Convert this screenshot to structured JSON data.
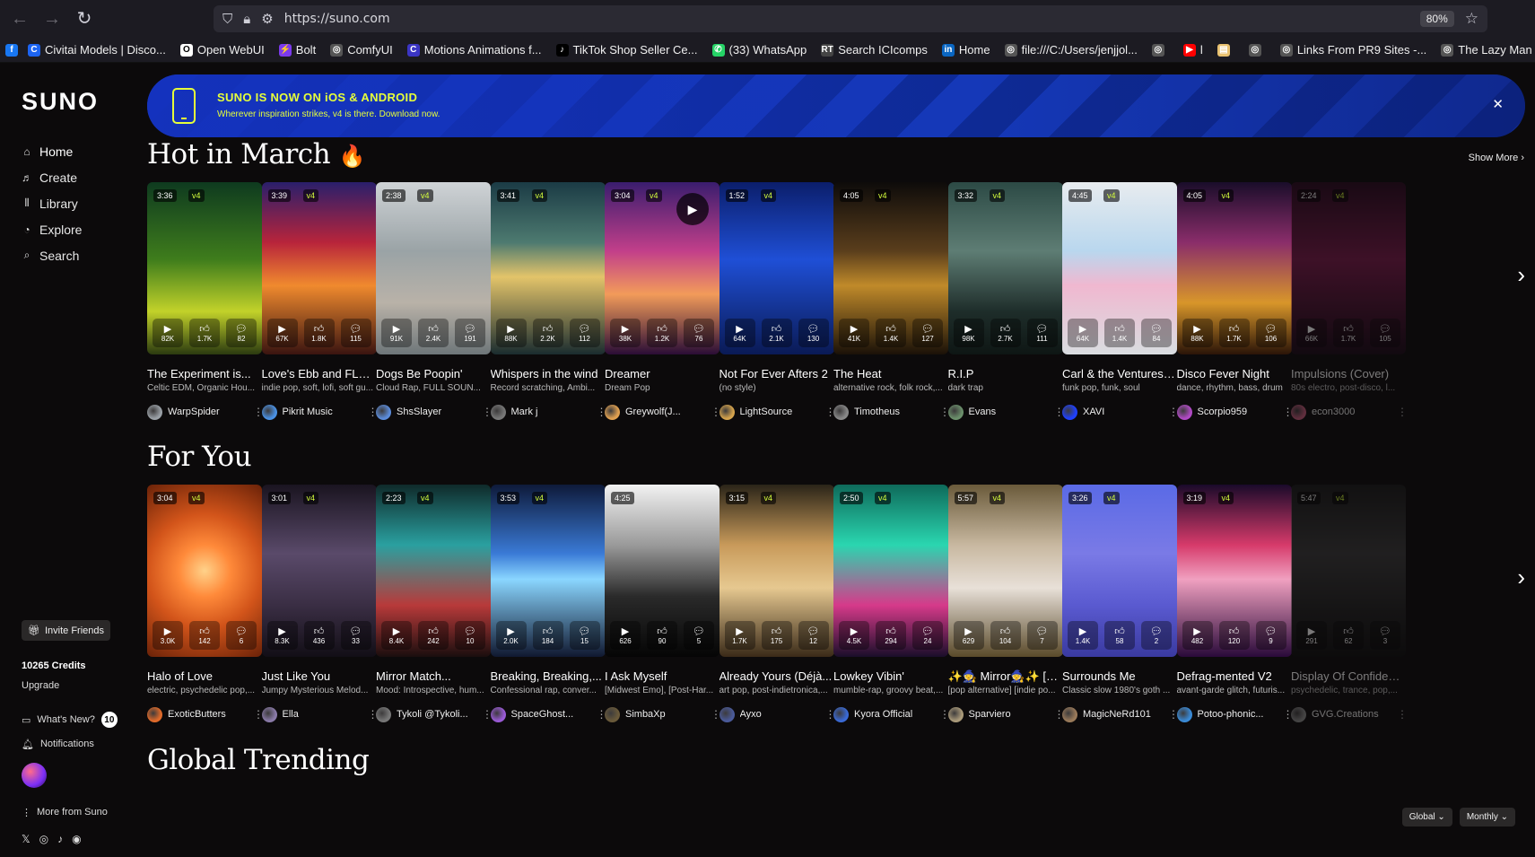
{
  "browser": {
    "url": "https://suno.com",
    "zoom": "80%",
    "bookmarks": [
      {
        "label": "Civitai Models | Disco...",
        "color": "#1c64f2",
        "glyph": "C"
      },
      {
        "label": "Open WebUI",
        "color": "#ffffff",
        "glyph": "O"
      },
      {
        "label": "Bolt",
        "color": "#7c3aed",
        "glyph": "⚡"
      },
      {
        "label": "ComfyUI",
        "color": "#555555",
        "glyph": "◎"
      },
      {
        "label": "Motions Animations f...",
        "color": "#3b35c4",
        "glyph": "C"
      },
      {
        "label": "TikTok Shop Seller Ce...",
        "color": "#000000",
        "glyph": "♪"
      },
      {
        "label": "(33) WhatsApp",
        "color": "#25d366",
        "glyph": "✆"
      },
      {
        "label": "Search ICIcomps",
        "color": "#444444",
        "glyph": "RT"
      },
      {
        "label": "Home",
        "color": "#0a66c2",
        "glyph": "in"
      },
      {
        "label": "file:///C:/Users/jenjjol...",
        "color": "#555555",
        "glyph": "◎"
      },
      {
        "label": "",
        "color": "#555555",
        "glyph": "◎"
      },
      {
        "label": "l",
        "color": "#ff0000",
        "glyph": "▶"
      },
      {
        "label": "",
        "color": "#e8c170",
        "glyph": "▤"
      },
      {
        "label": "",
        "color": "#555555",
        "glyph": "◎"
      },
      {
        "label": "Links From PR9 Sites -...",
        "color": "#555555",
        "glyph": "◎"
      },
      {
        "label": "The Lazy Man",
        "color": "#555555",
        "glyph": "◎"
      }
    ]
  },
  "sidebar": {
    "logo": "SUNO",
    "nav": [
      {
        "label": "Home",
        "icon": "⌂",
        "name": "home"
      },
      {
        "label": "Create",
        "icon": "♬",
        "name": "create"
      },
      {
        "label": "Library",
        "icon": "⫴",
        "name": "library"
      },
      {
        "label": "Explore",
        "icon": "◔",
        "name": "explore"
      },
      {
        "label": "Search",
        "icon": "⌕",
        "name": "search"
      }
    ],
    "invite": "Invite Friends",
    "credits": "10265 Credits",
    "upgrade": "Upgrade",
    "whats_new": "What's New?",
    "whats_new_count": "10",
    "notifications": "Notifications",
    "more_from_suno": "More from Suno"
  },
  "banner": {
    "title": "SUNO IS NOW ON iOS & ANDROID",
    "subtitle": "Wherever inspiration strikes, v4 is there. Download now."
  },
  "hot": {
    "title": "Hot in March",
    "emoji": "🔥",
    "show_more": "Show More",
    "cards": [
      {
        "duration": "3:36",
        "version": "v4",
        "plays": "82K",
        "likes": "1.7K",
        "comments": "82",
        "title": "The Experiment is...",
        "genre": "Celtic EDM, Organic Hou...",
        "user": "WarpSpider",
        "bg": "linear-gradient(180deg,#0e3a1f,#3f7d1c 45%,#c2d22a 75%,#2b3a10)",
        "avatar": "#9aa0a6"
      },
      {
        "duration": "3:39",
        "version": "v4",
        "plays": "67K",
        "likes": "1.8K",
        "comments": "115",
        "title": "Love's Ebb and FLOW",
        "genre": "indie pop, soft, lofi, soft gu...",
        "user": "Pikrit Music",
        "bg": "linear-gradient(180deg,#2a1f6b,#b8243b 35%,#f08a2e 60%,#3a1410)",
        "avatar": "#4a90e2"
      },
      {
        "duration": "2:38",
        "version": "v4",
        "plays": "91K",
        "likes": "2.4K",
        "comments": "191",
        "title": "Dogs Be Poopin'",
        "genre": "Cloud Rap, FULL SOUN...",
        "user": "ShsSlayer",
        "bg": "linear-gradient(180deg,#cfd3d6,#9aa3a6 40%,#b9b2a8 70%,#6e7679)",
        "avatar": "#5b8bd9"
      },
      {
        "duration": "3:41",
        "version": "v4",
        "plays": "88K",
        "likes": "2.2K",
        "comments": "112",
        "title": "Whispers in the wind",
        "genre": "Record scratching, Ambi...",
        "user": "Mark j",
        "bg": "linear-gradient(180deg,#1b3b45,#4d7a70 35%,#e3c46a 55%,#1a2c2f)",
        "avatar": "#777777"
      },
      {
        "duration": "3:04",
        "version": "v4",
        "plays": "38K",
        "likes": "1.2K",
        "comments": "76",
        "title": "Dreamer",
        "genre": "Dream Pop",
        "user": "Greywolf(J...",
        "bg": "linear-gradient(180deg,#3a1d6e,#c23f8a 40%,#f29b5a 65%,#2a0d36)",
        "avatar": "#e0a050",
        "playing": true
      },
      {
        "duration": "1:52",
        "version": "v4",
        "plays": "64K",
        "likes": "2.1K",
        "comments": "130",
        "title": "Not For Ever Afters 2",
        "genre": "(no style)",
        "user": "LightSource",
        "bg": "linear-gradient(180deg,#0b1e6b,#1f4fd6 45%,#0a1a55)",
        "avatar": "#d4a24c"
      },
      {
        "duration": "4:05",
        "version": "v4",
        "plays": "41K",
        "likes": "1.4K",
        "comments": "127",
        "title": "The Heat",
        "genre": "alternative rock, folk rock,...",
        "user": "Timotheus",
        "bg": "linear-gradient(180deg,#0d0b0a,#5a3e1c 40%,#c08a2a 60%,#1a1108)",
        "avatar": "#888888"
      },
      {
        "duration": "3:32",
        "version": "v4",
        "plays": "98K",
        "likes": "2.7K",
        "comments": "111",
        "title": "R.I.P",
        "genre": "dark trap",
        "user": "Evans",
        "bg": "linear-gradient(180deg,#2c4a45,#5e7d74 40%,#1e2d2a 75%,#0e1614)",
        "avatar": "#6b8f6b"
      },
      {
        "duration": "4:45",
        "version": "v4",
        "plays": "64K",
        "likes": "1.4K",
        "comments": "84",
        "title": "Carl & the Ventures -...",
        "genre": "funk pop, funk, soul",
        "user": "XAVI",
        "bg": "linear-gradient(180deg,#e8ecef,#b9d7ee 40%,#f0b8d0 60%,#d9dde0)",
        "avatar": "#1e40ff"
      },
      {
        "duration": "4:05",
        "version": "v4",
        "plays": "88K",
        "likes": "1.7K",
        "comments": "106",
        "title": "Disco Fever Night",
        "genre": "dance, rhythm, bass, drum",
        "user": "Scorpio959",
        "bg": "linear-gradient(180deg,#1a0d2a,#8a2d6a 35%,#d8962a 70%,#2a1408)",
        "avatar": "#b04ac4"
      },
      {
        "duration": "2:24",
        "version": "v4",
        "plays": "66K",
        "likes": "1.7K",
        "comments": "105",
        "title": "Impulsions (Cover)",
        "genre": "80s electro, post-disco, l...",
        "user": "econ3000",
        "bg": "linear-gradient(180deg,#2a0a20,#7a1a4a 45%,#1a0a18)",
        "avatar": "#c45a7a",
        "faded": true
      }
    ]
  },
  "foryou": {
    "title": "For You",
    "cards": [
      {
        "duration": "3:04",
        "version": "v4",
        "plays": "3.0K",
        "likes": "142",
        "comments": "6",
        "title": "Halo of Love",
        "genre": "electric, psychedelic pop,...",
        "user": "ExoticButters",
        "bg": "radial-gradient(circle at 50% 50%,#ffd28a 0,#ff8a3a 25%,#d2541a 55%,#6a2208)",
        "avatar": "#e06a2a"
      },
      {
        "duration": "3:01",
        "version": "v4",
        "plays": "8.3K",
        "likes": "436",
        "comments": "33",
        "title": "Just Like You",
        "genre": "Jumpy Mysterious Melod...",
        "user": "Ella",
        "bg": "linear-gradient(180deg,#1a1420,#5a4a6a 40%,#3a2e44 70%,#120e16)",
        "avatar": "#8a7aa8"
      },
      {
        "duration": "2:23",
        "version": "v4",
        "plays": "8.4K",
        "likes": "242",
        "comments": "10",
        "title": "Mirror Match...",
        "genre": "Mood: Introspective, hum...",
        "user": "Tykoli @Tykoli...",
        "bg": "linear-gradient(180deg,#0f2a2a,#2aa0a0 35%,#b83a3a 70%,#1a0e0e)",
        "avatar": "#777777"
      },
      {
        "duration": "3:53",
        "version": "v4",
        "plays": "2.0K",
        "likes": "184",
        "comments": "15",
        "title": "Breaking, Breaking,...",
        "genre": "Confessional rap, conver...",
        "user": "SpaceGhost...",
        "bg": "linear-gradient(180deg,#0e1a3a,#3a7ad6 40%,#8ad6ff 55%,#101830)",
        "avatar": "#9a5ad6"
      },
      {
        "duration": "4:25",
        "version": "",
        "plays": "626",
        "likes": "90",
        "comments": "5",
        "title": "I Ask Myself",
        "genre": "[Midwest Emo], [Post-Har...",
        "user": "SimbaXp",
        "bg": "linear-gradient(180deg,#f2f2f2,#9a9a9a 35%,#2a2a2a 65%,#050505)",
        "avatar": "#6a5a3a"
      },
      {
        "duration": "3:15",
        "version": "v4",
        "plays": "1.7K",
        "likes": "175",
        "comments": "12",
        "title": "Already Yours (Déjà...",
        "genre": "art pop, post-indietronica,...",
        "user": "Ayxo",
        "bg": "linear-gradient(180deg,#2a2418,#c89a5a 35%,#e6c890 60%,#3a2a18)",
        "avatar": "#4a5a9a"
      },
      {
        "duration": "2:50",
        "version": "v4",
        "plays": "4.5K",
        "likes": "294",
        "comments": "24",
        "title": "Lowkey Vibin'",
        "genre": "mumble-rap, groovy beat,...",
        "user": "Kyora Official",
        "bg": "linear-gradient(180deg,#0e6a5a,#2ad6b0 35%,#d63a8a 70%,#1a0e2a)",
        "avatar": "#3a6ad6"
      },
      {
        "duration": "5:57",
        "version": "v4",
        "plays": "629",
        "likes": "104",
        "comments": "7",
        "title": "✨🧙 Mirror🧙✨ [Alt...",
        "genre": "[pop alternative] [indie po...",
        "user": "Sparviero",
        "bg": "linear-gradient(180deg,#6a5a3a,#c8b8a0 35%,#e8e0d8 60%,#5a4a2a)",
        "avatar": "#aa9a7a"
      },
      {
        "duration": "3:26",
        "version": "v4",
        "plays": "1.4K",
        "likes": "58",
        "comments": "2",
        "title": "Surrounds Me",
        "genre": "Classic slow 1980's goth ...",
        "user": "MagicNeRd101",
        "bg": "linear-gradient(180deg,#5a6ae6,#7a7ae6 40%,#5a5ad0 70%,#3a3aa0)",
        "avatar": "#9a7a5a"
      },
      {
        "duration": "3:19",
        "version": "v4",
        "plays": "482",
        "likes": "120",
        "comments": "9",
        "title": "Defrag-mented V2",
        "genre": "avant-garde glitch, futuris...",
        "user": "Potoo-phonic...",
        "bg": "linear-gradient(180deg,#1a0a2a,#d63a6a 35%,#f0a0c0 55%,#2a0a3a)",
        "avatar": "#3a8ad6"
      },
      {
        "duration": "5:47",
        "version": "v4",
        "plays": "291",
        "likes": "62",
        "comments": "3",
        "title": "Display Of Confidence...",
        "genre": "psychedelic, trance, pop,...",
        "user": "GVG.Creations",
        "bg": "linear-gradient(180deg,#1a1a1a,#3a3a3a 40%,#0e0e0e)",
        "avatar": "#8a8a8a",
        "faded": true
      }
    ]
  },
  "global": {
    "title": "Global Trending",
    "region": "Global",
    "period": "Monthly"
  }
}
